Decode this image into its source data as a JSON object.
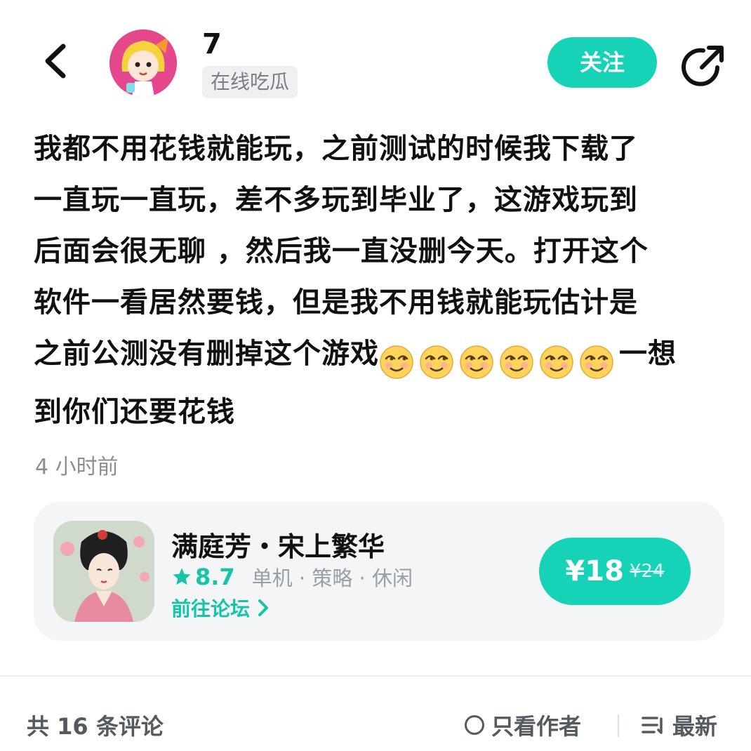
{
  "header": {
    "username": "7",
    "user_tag": "在线吃瓜",
    "follow_label": "关注"
  },
  "post": {
    "lines": [
      "我都不用花钱就能玩，之前测试的时候我下载了",
      "一直玩一直玩，差不多玩到毕业了，这游戏玩到",
      "后面会很无聊 ，然后我一直没删今天。打开这个",
      "软件一看居然要钱，但是我不用钱就能玩估计是"
    ],
    "line5_text": "之前公测没有删掉这个游戏",
    "line5_tail": "一想",
    "line6": "到你们还要花钱",
    "emoji_name": "smirk-emoji",
    "emoji_count": 6,
    "timestamp": "4 小时前"
  },
  "game_card": {
    "title": "满庭芳・宋上繁华",
    "rating": "8.7",
    "tags": "单机 · 策略 · 休闲",
    "forum_link": "前往论坛",
    "price": "¥18",
    "original_price": "¥24",
    "accent_color": "#16d3b7"
  },
  "footer": {
    "comment_count": "共 16 条评论",
    "author_only": "只看作者",
    "sort_label": "最新"
  }
}
